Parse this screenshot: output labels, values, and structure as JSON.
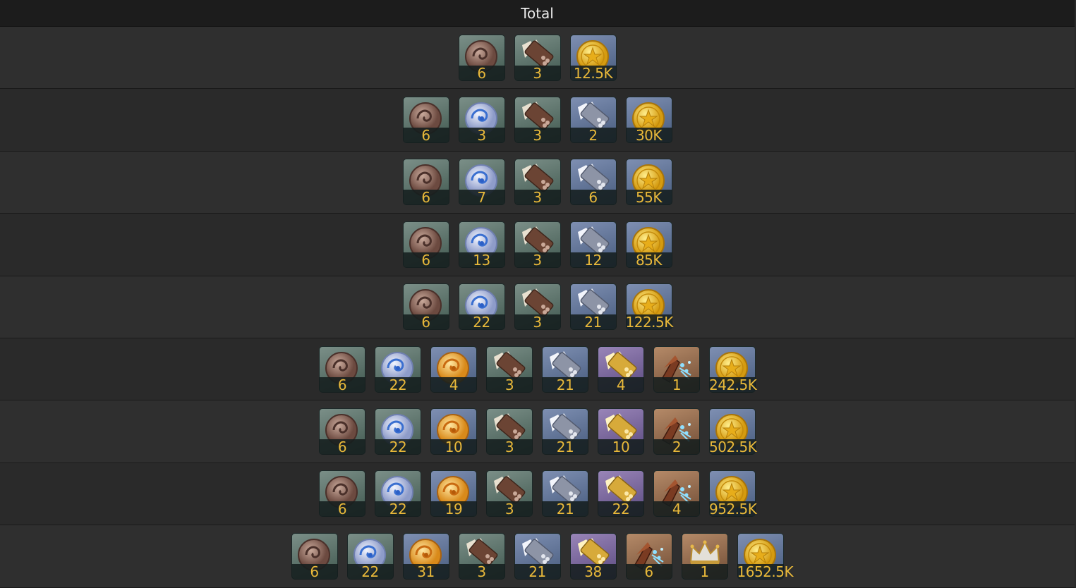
{
  "header": {
    "title": "Total"
  },
  "items": {
    "bronze-orb": {
      "name": "bronze-orb-icon",
      "bg": "bg-g"
    },
    "silver-orb": {
      "name": "silver-orb-icon",
      "bg": "bg-g"
    },
    "gold-orb": {
      "name": "gold-orb-icon",
      "bg": "bg-b"
    },
    "brown-scroll": {
      "name": "brown-scroll-icon",
      "bg": "bg-g"
    },
    "silver-scroll": {
      "name": "silver-scroll-icon",
      "bg": "bg-b"
    },
    "gold-scroll": {
      "name": "gold-scroll-icon",
      "bg": "bg-p"
    },
    "shard": {
      "name": "shard-icon",
      "bg": "bg-o"
    },
    "crown": {
      "name": "crown-icon",
      "bg": "bg-o"
    },
    "gold-coin": {
      "name": "gold-coin-icon",
      "bg": "bg-b"
    }
  },
  "rows": [
    [
      {
        "item": "bronze-orb",
        "count": "6"
      },
      {
        "item": "brown-scroll",
        "count": "3"
      },
      {
        "item": "gold-coin",
        "count": "12.5K"
      }
    ],
    [
      {
        "item": "bronze-orb",
        "count": "6"
      },
      {
        "item": "silver-orb",
        "count": "3"
      },
      {
        "item": "brown-scroll",
        "count": "3"
      },
      {
        "item": "silver-scroll",
        "count": "2"
      },
      {
        "item": "gold-coin",
        "count": "30K"
      }
    ],
    [
      {
        "item": "bronze-orb",
        "count": "6"
      },
      {
        "item": "silver-orb",
        "count": "7"
      },
      {
        "item": "brown-scroll",
        "count": "3"
      },
      {
        "item": "silver-scroll",
        "count": "6"
      },
      {
        "item": "gold-coin",
        "count": "55K"
      }
    ],
    [
      {
        "item": "bronze-orb",
        "count": "6"
      },
      {
        "item": "silver-orb",
        "count": "13"
      },
      {
        "item": "brown-scroll",
        "count": "3"
      },
      {
        "item": "silver-scroll",
        "count": "12"
      },
      {
        "item": "gold-coin",
        "count": "85K"
      }
    ],
    [
      {
        "item": "bronze-orb",
        "count": "6"
      },
      {
        "item": "silver-orb",
        "count": "22"
      },
      {
        "item": "brown-scroll",
        "count": "3"
      },
      {
        "item": "silver-scroll",
        "count": "21"
      },
      {
        "item": "gold-coin",
        "count": "122.5K"
      }
    ],
    [
      {
        "item": "bronze-orb",
        "count": "6"
      },
      {
        "item": "silver-orb",
        "count": "22"
      },
      {
        "item": "gold-orb",
        "count": "4"
      },
      {
        "item": "brown-scroll",
        "count": "3"
      },
      {
        "item": "silver-scroll",
        "count": "21"
      },
      {
        "item": "gold-scroll",
        "count": "4"
      },
      {
        "item": "shard",
        "count": "1"
      },
      {
        "item": "gold-coin",
        "count": "242.5K"
      }
    ],
    [
      {
        "item": "bronze-orb",
        "count": "6"
      },
      {
        "item": "silver-orb",
        "count": "22"
      },
      {
        "item": "gold-orb",
        "count": "10"
      },
      {
        "item": "brown-scroll",
        "count": "3"
      },
      {
        "item": "silver-scroll",
        "count": "21"
      },
      {
        "item": "gold-scroll",
        "count": "10"
      },
      {
        "item": "shard",
        "count": "2"
      },
      {
        "item": "gold-coin",
        "count": "502.5K"
      }
    ],
    [
      {
        "item": "bronze-orb",
        "count": "6"
      },
      {
        "item": "silver-orb",
        "count": "22"
      },
      {
        "item": "gold-orb",
        "count": "19"
      },
      {
        "item": "brown-scroll",
        "count": "3"
      },
      {
        "item": "silver-scroll",
        "count": "21"
      },
      {
        "item": "gold-scroll",
        "count": "22"
      },
      {
        "item": "shard",
        "count": "4"
      },
      {
        "item": "gold-coin",
        "count": "952.5K"
      }
    ],
    [
      {
        "item": "bronze-orb",
        "count": "6"
      },
      {
        "item": "silver-orb",
        "count": "22"
      },
      {
        "item": "gold-orb",
        "count": "31"
      },
      {
        "item": "brown-scroll",
        "count": "3"
      },
      {
        "item": "silver-scroll",
        "count": "21"
      },
      {
        "item": "gold-scroll",
        "count": "38"
      },
      {
        "item": "shard",
        "count": "6"
      },
      {
        "item": "crown",
        "count": "1"
      },
      {
        "item": "gold-coin",
        "count": "1652.5K"
      }
    ]
  ]
}
